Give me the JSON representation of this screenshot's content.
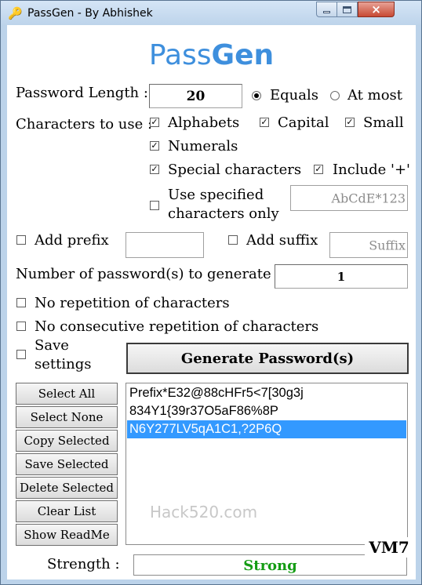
{
  "window": {
    "title": "PassGen - By Abhishek",
    "icon": "key-icon",
    "controls": {
      "minimize": "minimize-icon",
      "maximize": "maximize-icon",
      "close": "×"
    }
  },
  "app": {
    "title_light": "Pass",
    "title_bold": "Gen"
  },
  "length": {
    "label": "Password Length :",
    "value": "20",
    "mode_options": [
      "Equals",
      "At most"
    ],
    "mode_selected": "Equals"
  },
  "chars": {
    "label": "Characters to use :",
    "alphabets": {
      "label": "Alphabets",
      "checked": true
    },
    "capital": {
      "label": "Capital",
      "checked": true
    },
    "small": {
      "label": "Small",
      "checked": true
    },
    "numerals": {
      "label": "Numerals",
      "checked": true
    },
    "special": {
      "label": "Special characters",
      "checked": true
    },
    "include_plus": {
      "label": "Include '+'",
      "checked": true
    },
    "specified": {
      "label_line1": "Use specified",
      "label_line2": "characters only",
      "checked": false,
      "placeholder": "AbCdE*123"
    }
  },
  "prefix": {
    "label": "Add prefix",
    "checked": false,
    "value": ""
  },
  "suffix": {
    "label": "Add suffix",
    "checked": false,
    "placeholder": "Suffix"
  },
  "count": {
    "label": "Number of password(s) to generate :",
    "value": "1"
  },
  "options": {
    "no_repetition": {
      "label": "No repetition of characters",
      "checked": false
    },
    "no_consecutive": {
      "label": "No consecutive repetition of characters",
      "checked": false
    },
    "save_settings": {
      "label_line1": "Save",
      "label_line2": "settings",
      "checked": false
    }
  },
  "generate_label": "Generate Password(s)",
  "actions": {
    "select_all": "Select All",
    "select_none": "Select None",
    "copy_selected": "Copy Selected",
    "save_selected": "Save Selected",
    "delete_selected": "Delete Selected",
    "clear_list": "Clear List",
    "show_readme": "Show ReadMe"
  },
  "passwords": [
    "Prefix*E32@88cHFr5<7[30g3j",
    "834Y1{39r37O5aF86%8P",
    "N6Y277LV5qA1C1,?2P6Q"
  ],
  "selected_password_index": 2,
  "watermark": "Hack520.com",
  "strength": {
    "label": "Strength :",
    "value": "Strong",
    "color": "#149c14"
  },
  "badge": "VM7",
  "colors": {
    "title_blue": "#3e8fdd",
    "selection": "#3399ff",
    "close_red": "#c74a34"
  }
}
